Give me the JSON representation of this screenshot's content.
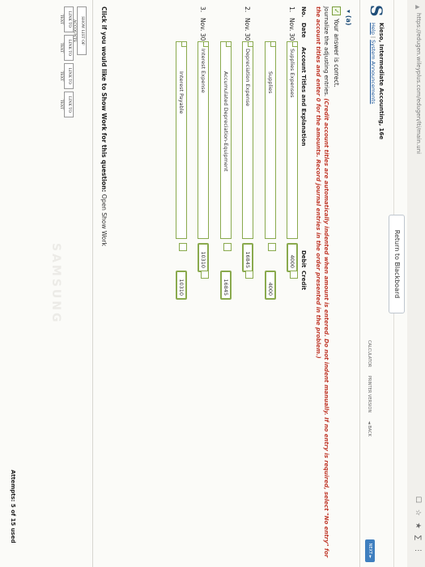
{
  "browser": {
    "url": "https://edugen.wileyplus.com/edugen/lti/main.uni"
  },
  "topbar": {
    "return_label": "Return to Blackboard"
  },
  "header": {
    "logo_letter": "S",
    "course_title": "Kieso, Intermediate Accounting, 16e",
    "links": [
      "Help",
      "System Announcements"
    ],
    "tools": [
      "CALCULATOR",
      "PRINTER VERSION",
      "◄ BACK"
    ],
    "next_label": "NEXT ►"
  },
  "question": {
    "section": "▾ (a)",
    "correct_msg": "Your answer is correct.",
    "instr_plain": "Journalize the adjusting entries.",
    "instr_red": "(Credit account titles are automatically indented when amount is entered. Do not indent manually. If no entry is required, select \"No entry\" for the account titles and enter 0 for the amounts. Record journal entries in the order presented in the problem.)"
  },
  "table": {
    "headers": {
      "no": "No.",
      "date": "Date",
      "account": "Account Titles and Explanation",
      "debit": "Debit",
      "credit": "Credit"
    },
    "entries": [
      {
        "no": "1.",
        "date": "Nov. 30",
        "rows": [
          {
            "account": "Supplies Expenses",
            "debit": "4000",
            "credit": ""
          },
          {
            "account": "Supplies",
            "debit": "",
            "credit": "4000"
          }
        ]
      },
      {
        "no": "2.",
        "date": "Nov. 30",
        "rows": [
          {
            "account": "Depreciation Expense",
            "debit": "16845",
            "credit": ""
          },
          {
            "account": "Accumulated Depreciation-Equipment",
            "debit": "",
            "credit": "16845"
          }
        ]
      },
      {
        "no": "3.",
        "date": "Nov. 30",
        "rows": [
          {
            "account": "Interest Expense",
            "debit": "10310",
            "credit": ""
          },
          {
            "account": "Interest Payable",
            "debit": "",
            "credit": "10310"
          }
        ]
      }
    ]
  },
  "showwork": {
    "question": "Click if you would like to Show Work for this question:",
    "link": "Open Show Work"
  },
  "buttons": {
    "show_list": "SHOW LIST OF ACCOUNTS",
    "links": [
      "LINK TO TEXT",
      "LINK TO TEXT",
      "LINK TO TEXT",
      "LINK TO TEXT"
    ]
  },
  "attempts": "Attempts: 5 of 15 used",
  "watermark": "SAMSUNG"
}
